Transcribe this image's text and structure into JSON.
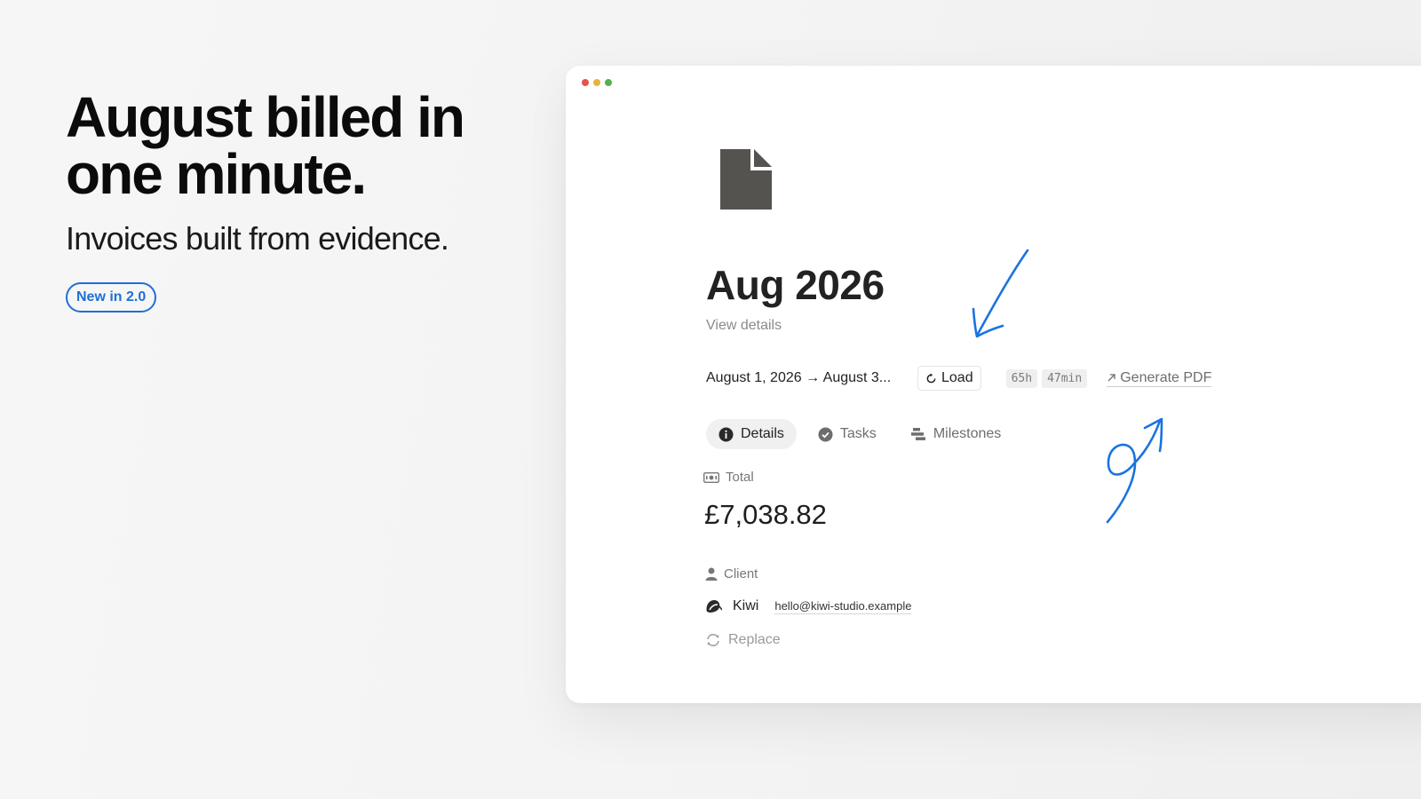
{
  "hero": {
    "title_line1": "August billed in",
    "title_line2": "one minute.",
    "subtitle": "Invoices built from evidence.",
    "badge": "New in 2.0"
  },
  "window": {
    "dots": [
      "#e5534b",
      "#e6b33e",
      "#53b24f"
    ]
  },
  "invoice": {
    "title": "Aug 2026",
    "view_details": "View details",
    "date_range": "August 1, 2026 → August 3...",
    "load_label": "Load",
    "hours_chip": "65h",
    "minutes_chip": "47min",
    "generate_pdf": "Generate PDF"
  },
  "tabs": [
    {
      "label": "Details",
      "active": true
    },
    {
      "label": "Tasks",
      "active": false
    },
    {
      "label": "Milestones",
      "active": false
    }
  ],
  "total": {
    "label": "Total",
    "value": "£7,038.82"
  },
  "client": {
    "label": "Client",
    "name": "Kiwi",
    "email": "hello@kiwi-studio.example",
    "replace_label": "Replace"
  },
  "colors": {
    "accent": "#1f6fd6",
    "annotation": "#1a73e0",
    "doc_icon": "#555350"
  }
}
